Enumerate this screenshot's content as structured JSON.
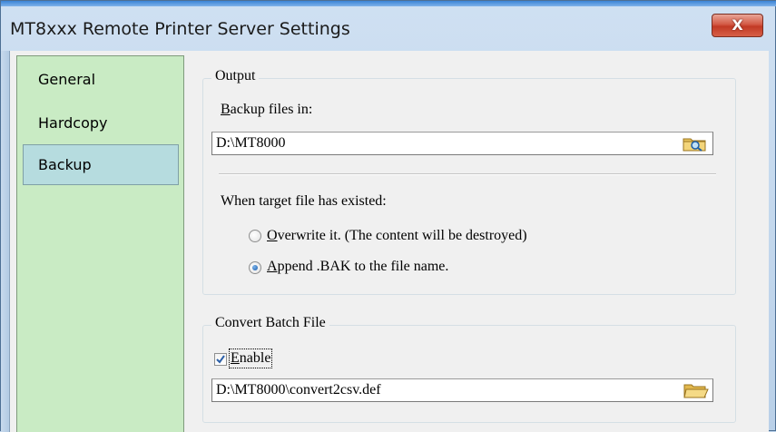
{
  "window": {
    "title": "MT8xxx Remote Printer Server Settings",
    "close_glyph": "X"
  },
  "sidebar": {
    "items": [
      {
        "label": "General",
        "selected": false
      },
      {
        "label": "Hardcopy",
        "selected": false
      },
      {
        "label": "Backup",
        "selected": true
      }
    ]
  },
  "output": {
    "group_title": "Output",
    "backup_label_first": "B",
    "backup_label_rest": "ackup files in:",
    "backup_path": "D:\\MT8000",
    "browse_icon": "folder-search-icon",
    "when_exists_label": "When target file has existed:",
    "overwrite_first": "O",
    "overwrite_rest": "verwrite it. (The content will be destroyed)",
    "overwrite_checked": false,
    "append_first": "A",
    "append_rest": "ppend .BAK to the file name.",
    "append_checked": true
  },
  "convert": {
    "group_title": "Convert Batch File",
    "enable_first": "E",
    "enable_rest": "nable",
    "enable_checked": true,
    "file_path": "D:\\MT8000\\convert2csv.def",
    "open_icon": "folder-open-icon"
  },
  "colors": {
    "sidebar_bg": "#c9ebc4",
    "selected_item_bg": "#b6dcdf",
    "close_button": "#c9452f"
  }
}
